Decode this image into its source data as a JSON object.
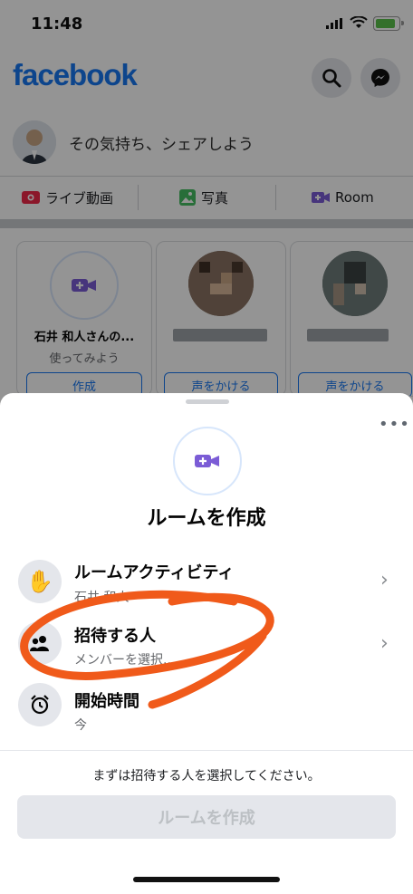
{
  "status_bar": {
    "time": "11:48"
  },
  "header": {
    "logo": "facebook",
    "search_icon": "search-icon",
    "messenger_icon": "messenger-icon"
  },
  "composer": {
    "placeholder": "その気持ち、シェアしよう"
  },
  "actions": [
    {
      "label": "ライブ動画",
      "icon": "live-video-icon",
      "color": "#f02849"
    },
    {
      "label": "写真",
      "icon": "photo-icon",
      "color": "#45bd62"
    },
    {
      "label": "Room",
      "icon": "room-icon",
      "color": "#7b5cd6"
    }
  ],
  "stories": {
    "create_card": {
      "name": "石井 和人さんの...",
      "subtitle": "使ってみよう",
      "button": "作成"
    },
    "friends": [
      {
        "button": "声をかける"
      },
      {
        "button": "声をかける"
      }
    ]
  },
  "sheet": {
    "title": "ルームを作成",
    "more": "•••",
    "rows": [
      {
        "title": "ルームアクティビティ",
        "subtitle": "石井 和人",
        "icon": "waving-hand-icon"
      },
      {
        "title": "招待する人",
        "subtitle": "メンバーを選択...",
        "icon": "people-icon"
      },
      {
        "title": "開始時間",
        "subtitle": "今",
        "icon": "alarm-clock-icon"
      }
    ],
    "note": "まずは招待する人を選択してください。",
    "create_button": "ルームを作成"
  },
  "colors": {
    "brand": "#1877f2",
    "room_purple": "#7b5cd6",
    "annotation": "#f05a1a"
  }
}
